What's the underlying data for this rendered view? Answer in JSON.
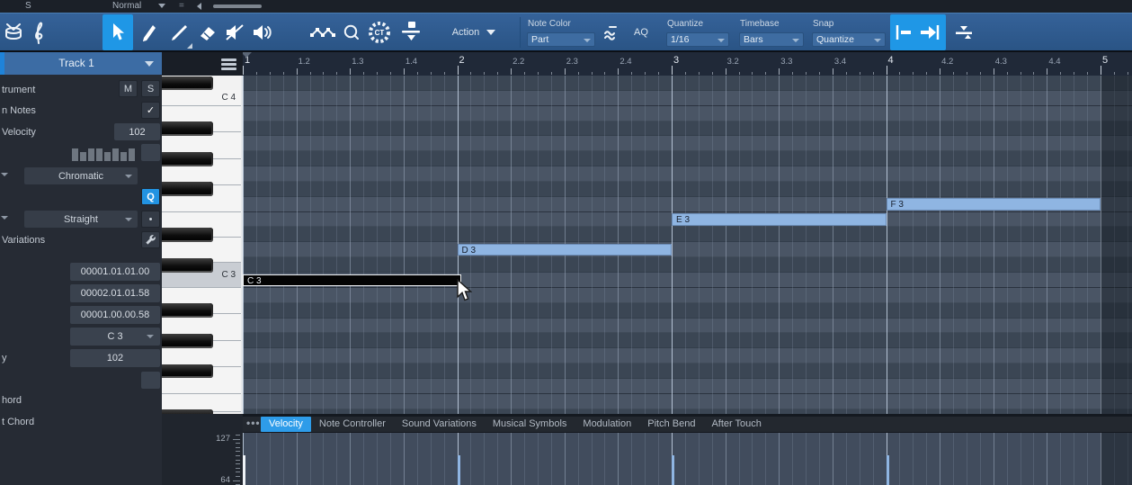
{
  "top_strip": {
    "s_label": "S",
    "mode_value": "Normal"
  },
  "toolbar": {
    "action_label": "Action",
    "ct_label": "CT",
    "aq_label": "AQ",
    "note_color_label": "Note Color",
    "note_color_value": "Part",
    "quantize_label": "Quantize",
    "quantize_value": "1/16",
    "timebase_label": "Timebase",
    "timebase_value": "Bars",
    "snap_label": "Snap",
    "snap_value": "Quantize"
  },
  "sidebar": {
    "track_title": "Track 1",
    "instrument_label": "trument",
    "mute_label": "M",
    "solo_label": "S",
    "notes_label": "n Notes",
    "check_glyph": "✓",
    "velocity_label": "Velocity",
    "velocity_value": "102",
    "scale_value": "Chromatic",
    "quantize_button_label": "Q",
    "swing_value": "Straight",
    "dot_button_label": "•",
    "variations_label": "Variations",
    "note_start_value": "00001.01.01.00",
    "note_end_value": "00002.01.01.58",
    "note_length_value": "00001.00.00.58",
    "note_pitch_value": "C 3",
    "note_velocity_value": "102",
    "velocity_partial_label": "y",
    "chord_partial_label_1": "hord",
    "chord_partial_label_2": "t Chord"
  },
  "ruler": {
    "labels": [
      "1",
      "1.2",
      "1.3",
      "1.4",
      "2",
      "2.2",
      "2.3",
      "2.4",
      "3",
      "3.2",
      "3.3",
      "3.4",
      "4",
      "4.2",
      "4.3",
      "4.4",
      "5"
    ]
  },
  "keyboard": {
    "rows_top_to_bottom": [
      "C#4",
      "C4",
      "B3",
      "A#3",
      "A3",
      "G#3",
      "G3",
      "F#3",
      "F3",
      "E3",
      "D#3",
      "D3",
      "C#3",
      "C3",
      "B2",
      "A#2",
      "A2",
      "G#2",
      "G2",
      "F#2",
      "F2",
      "E2",
      "D#2"
    ],
    "labels": [
      {
        "pitch": "C4",
        "text": "C 4"
      },
      {
        "pitch": "C3",
        "text": "C 3"
      }
    ],
    "highlighted_key": "C3"
  },
  "notes": [
    {
      "label": "C 3",
      "pitch": "C3",
      "start_bar": 1.0,
      "end_bar": 2.017,
      "velocity": 102,
      "selected": true
    },
    {
      "label": "D 3",
      "pitch": "D3",
      "start_bar": 2.0,
      "end_bar": 3.0,
      "velocity": 102,
      "selected": false
    },
    {
      "label": "E 3",
      "pitch": "E3",
      "start_bar": 3.0,
      "end_bar": 4.0,
      "velocity": 102,
      "selected": false
    },
    {
      "label": "F 3",
      "pitch": "F3",
      "start_bar": 4.0,
      "end_bar": 5.0,
      "velocity": 102,
      "selected": false
    }
  ],
  "lane": {
    "menu_label": "•••",
    "tabs": [
      "Velocity",
      "Note Controller",
      "Sound Variations",
      "Musical Symbols",
      "Modulation",
      "Pitch Bend",
      "After Touch"
    ],
    "selected_tab": "Velocity",
    "ruler_max": "127",
    "ruler_mid": "64"
  },
  "colors": {
    "accent": "#1f97e6",
    "note_fill": "#8fb5e2",
    "note_text": "#17202e",
    "note_selected_fill": "#040404",
    "stem_selected": "#eef2f6",
    "grid_light_row": "#4a5565",
    "grid_dark_row": "#3b4654"
  }
}
